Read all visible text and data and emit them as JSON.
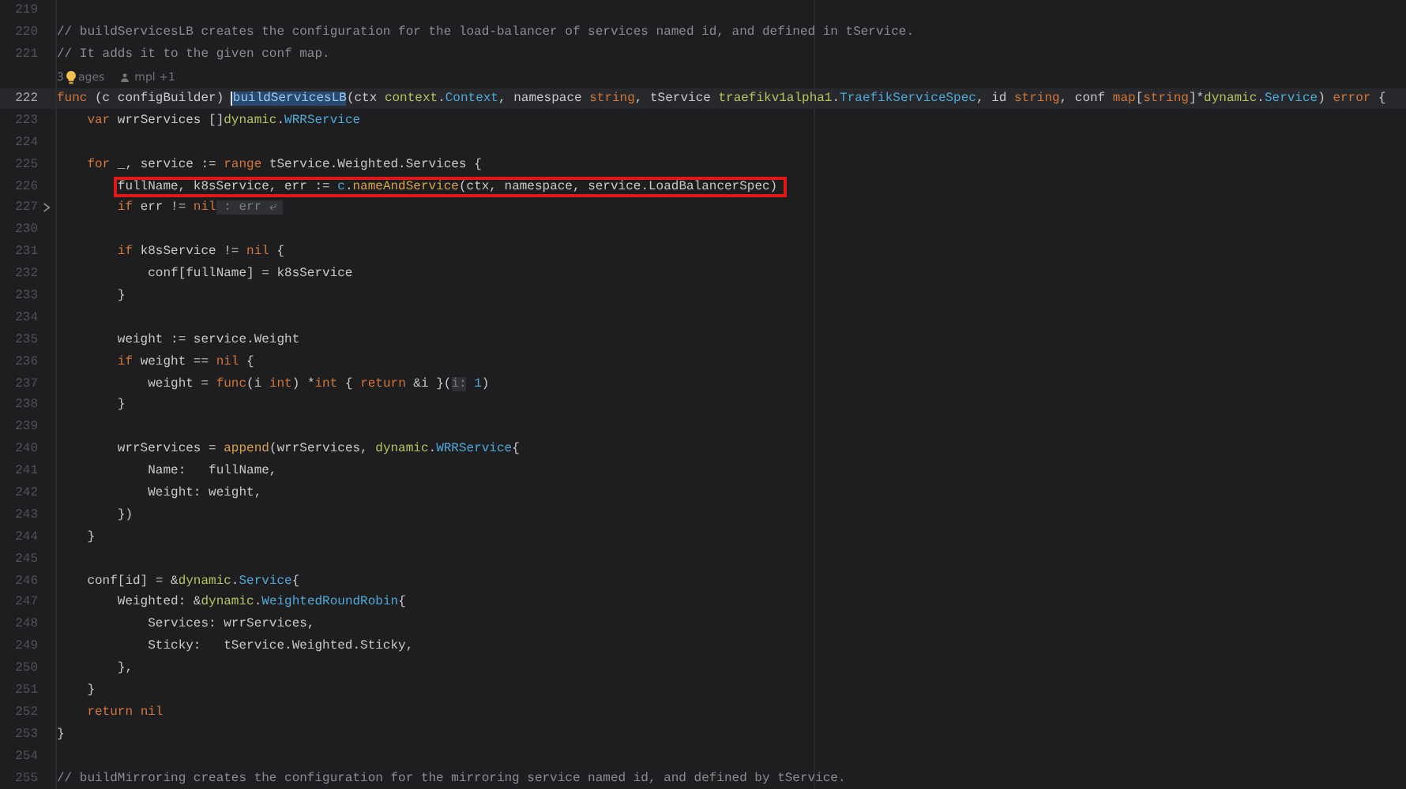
{
  "lines": [
    {
      "kind": "code",
      "number": "219"
    },
    {
      "kind": "code",
      "number": "220",
      "tokens": [
        {
          "kind": "cm",
          "text": "// buildServicesLB creates the configuration for the load-balancer of services named id, and defined in tService."
        }
      ]
    },
    {
      "kind": "code",
      "number": "221",
      "tokens": [
        {
          "kind": "cm",
          "text": "// It adds it to the given conf map."
        }
      ]
    },
    {
      "kind": "lens",
      "count": "3",
      "label": "ages",
      "author": "mpl +1"
    },
    {
      "kind": "code",
      "number": "222",
      "current": true,
      "tokens": [
        {
          "kind": "kw",
          "text": "func"
        },
        {
          "kind": "p",
          "text": " (c configBuilder) "
        },
        {
          "kind": "sel",
          "text": "buildServicesLB"
        },
        {
          "kind": "p",
          "text": "(ctx "
        },
        {
          "kind": "pkg",
          "text": "context"
        },
        {
          "kind": "p",
          "text": "."
        },
        {
          "kind": "type",
          "text": "Context"
        },
        {
          "kind": "p",
          "text": ", namespace "
        },
        {
          "kind": "kw",
          "text": "string"
        },
        {
          "kind": "p",
          "text": ", tService "
        },
        {
          "kind": "pkg",
          "text": "traefikv1alpha1"
        },
        {
          "kind": "p",
          "text": "."
        },
        {
          "kind": "type",
          "text": "TraefikServiceSpec"
        },
        {
          "kind": "p",
          "text": ", id "
        },
        {
          "kind": "kw",
          "text": "string"
        },
        {
          "kind": "p",
          "text": ", conf "
        },
        {
          "kind": "kw",
          "text": "map"
        },
        {
          "kind": "p",
          "text": "["
        },
        {
          "kind": "kw",
          "text": "string"
        },
        {
          "kind": "p",
          "text": "]*"
        },
        {
          "kind": "pkg",
          "text": "dynamic"
        },
        {
          "kind": "p",
          "text": "."
        },
        {
          "kind": "type",
          "text": "Service"
        },
        {
          "kind": "p",
          "text": ") "
        },
        {
          "kind": "kw",
          "text": "error"
        },
        {
          "kind": "p",
          "text": " {"
        }
      ]
    },
    {
      "kind": "code",
      "number": "223",
      "tokens": [
        {
          "kind": "kw",
          "text": "    var"
        },
        {
          "kind": "p",
          "text": " wrrServices []"
        },
        {
          "kind": "pkg",
          "text": "dynamic"
        },
        {
          "kind": "p",
          "text": "."
        },
        {
          "kind": "type",
          "text": "WRRService"
        }
      ]
    },
    {
      "kind": "code",
      "number": "224"
    },
    {
      "kind": "code",
      "number": "225",
      "tokens": [
        {
          "kind": "kw",
          "text": "    for"
        },
        {
          "kind": "p",
          "text": " _, service := "
        },
        {
          "kind": "kw",
          "text": "range"
        },
        {
          "kind": "p",
          "text": " tService.Weighted.Services {"
        }
      ]
    },
    {
      "kind": "code",
      "number": "226",
      "boxed": true,
      "tokens": [
        {
          "kind": "p",
          "text": "fullName, k8sService, err := "
        },
        {
          "kind": "recv",
          "text": "c"
        },
        {
          "kind": "p",
          "text": "."
        },
        {
          "kind": "call",
          "text": "nameAndService"
        },
        {
          "kind": "p",
          "text": "(ctx, namespace, service.LoadBalancerSpec)"
        }
      ]
    },
    {
      "kind": "code",
      "number": "227",
      "folded": true,
      "tokens": [
        {
          "kind": "kw",
          "text": "        if"
        },
        {
          "kind": "p",
          "text": " err != "
        },
        {
          "kind": "kw",
          "text": "nil"
        },
        {
          "kind": "hint",
          "text": " : err ⤶ "
        }
      ]
    },
    {
      "kind": "code",
      "number": "230"
    },
    {
      "kind": "code",
      "number": "231",
      "tokens": [
        {
          "kind": "kw",
          "text": "        if"
        },
        {
          "kind": "p",
          "text": " k8sService != "
        },
        {
          "kind": "kw",
          "text": "nil"
        },
        {
          "kind": "p",
          "text": " {"
        }
      ]
    },
    {
      "kind": "code",
      "number": "232",
      "tokens": [
        {
          "kind": "p",
          "text": "            conf[fullName] = k8sService"
        }
      ]
    },
    {
      "kind": "code",
      "number": "233",
      "tokens": [
        {
          "kind": "p",
          "text": "        }"
        }
      ]
    },
    {
      "kind": "code",
      "number": "234"
    },
    {
      "kind": "code",
      "number": "235",
      "tokens": [
        {
          "kind": "p",
          "text": "        weight := service.Weight"
        }
      ]
    },
    {
      "kind": "code",
      "number": "236",
      "tokens": [
        {
          "kind": "kw",
          "text": "        if"
        },
        {
          "kind": "p",
          "text": " weight == "
        },
        {
          "kind": "kw",
          "text": "nil"
        },
        {
          "kind": "p",
          "text": " {"
        }
      ]
    },
    {
      "kind": "code",
      "number": "237",
      "tokens": [
        {
          "kind": "p",
          "text": "            weight = "
        },
        {
          "kind": "kw",
          "text": "func"
        },
        {
          "kind": "p",
          "text": "(i "
        },
        {
          "kind": "kw",
          "text": "int"
        },
        {
          "kind": "p",
          "text": ") *"
        },
        {
          "kind": "kw",
          "text": "int"
        },
        {
          "kind": "p",
          "text": " { "
        },
        {
          "kind": "kw",
          "text": "return"
        },
        {
          "kind": "p",
          "text": " &i }("
        },
        {
          "kind": "hint",
          "text": "i:"
        },
        {
          "kind": "num",
          "text": " 1"
        },
        {
          "kind": "p",
          "text": ")"
        }
      ]
    },
    {
      "kind": "code",
      "number": "238",
      "tokens": [
        {
          "kind": "p",
          "text": "        }"
        }
      ]
    },
    {
      "kind": "code",
      "number": "239"
    },
    {
      "kind": "code",
      "number": "240",
      "tokens": [
        {
          "kind": "p",
          "text": "        wrrServices = "
        },
        {
          "kind": "call",
          "text": "append"
        },
        {
          "kind": "p",
          "text": "(wrrServices, "
        },
        {
          "kind": "pkg",
          "text": "dynamic"
        },
        {
          "kind": "p",
          "text": "."
        },
        {
          "kind": "type",
          "text": "WRRService"
        },
        {
          "kind": "p",
          "text": "{"
        }
      ]
    },
    {
      "kind": "code",
      "number": "241",
      "tokens": [
        {
          "kind": "p",
          "text": "            Name:   fullName,"
        }
      ]
    },
    {
      "kind": "code",
      "number": "242",
      "tokens": [
        {
          "kind": "p",
          "text": "            Weight: weight,"
        }
      ]
    },
    {
      "kind": "code",
      "number": "243",
      "tokens": [
        {
          "kind": "p",
          "text": "        })"
        }
      ]
    },
    {
      "kind": "code",
      "number": "244",
      "tokens": [
        {
          "kind": "p",
          "text": "    }"
        }
      ]
    },
    {
      "kind": "code",
      "number": "245"
    },
    {
      "kind": "code",
      "number": "246",
      "tokens": [
        {
          "kind": "p",
          "text": "    conf[id] = &"
        },
        {
          "kind": "pkg",
          "text": "dynamic"
        },
        {
          "kind": "p",
          "text": "."
        },
        {
          "kind": "type",
          "text": "Service"
        },
        {
          "kind": "p",
          "text": "{"
        }
      ]
    },
    {
      "kind": "code",
      "number": "247",
      "tokens": [
        {
          "kind": "p",
          "text": "        Weighted: &"
        },
        {
          "kind": "pkg",
          "text": "dynamic"
        },
        {
          "kind": "p",
          "text": "."
        },
        {
          "kind": "type",
          "text": "WeightedRoundRobin"
        },
        {
          "kind": "p",
          "text": "{"
        }
      ]
    },
    {
      "kind": "code",
      "number": "248",
      "tokens": [
        {
          "kind": "p",
          "text": "            Services: wrrServices,"
        }
      ]
    },
    {
      "kind": "code",
      "number": "249",
      "tokens": [
        {
          "kind": "p",
          "text": "            Sticky:   tService.Weighted.Sticky,"
        }
      ]
    },
    {
      "kind": "code",
      "number": "250",
      "tokens": [
        {
          "kind": "p",
          "text": "        },"
        }
      ]
    },
    {
      "kind": "code",
      "number": "251",
      "tokens": [
        {
          "kind": "p",
          "text": "    }"
        }
      ]
    },
    {
      "kind": "code",
      "number": "252",
      "tokens": [
        {
          "kind": "kw",
          "text": "    return"
        },
        {
          "kind": "kw",
          "text": " nil"
        }
      ]
    },
    {
      "kind": "code",
      "number": "253",
      "tokens": [
        {
          "kind": "p",
          "text": "}"
        }
      ]
    },
    {
      "kind": "code",
      "number": "254"
    },
    {
      "kind": "code",
      "number": "255",
      "tokens": [
        {
          "kind": "cm",
          "text": "// buildMirroring creates the configuration for the mirroring service named id, and defined by tService."
        }
      ]
    }
  ]
}
